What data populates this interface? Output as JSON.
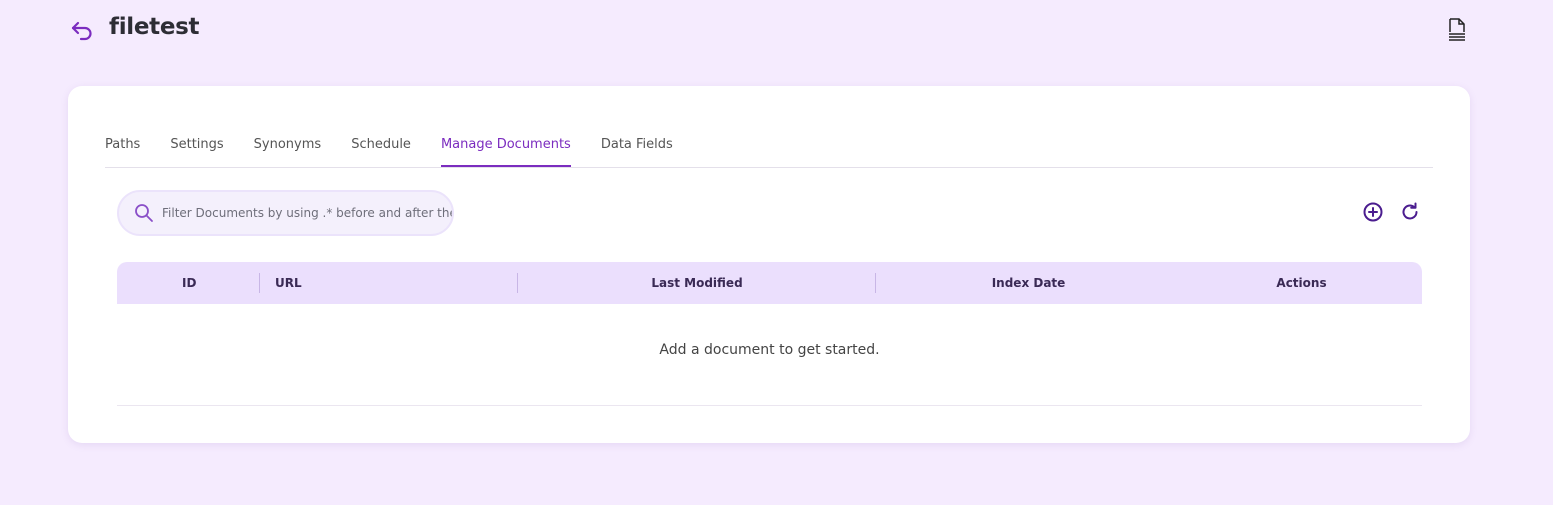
{
  "header": {
    "title": "filetest",
    "back_icon": "undo-arrow-icon",
    "doc_icon": "document-lines-icon"
  },
  "tabs": [
    {
      "label": "Paths",
      "active": false
    },
    {
      "label": "Settings",
      "active": false
    },
    {
      "label": "Synonyms",
      "active": false
    },
    {
      "label": "Schedule",
      "active": false
    },
    {
      "label": "Manage Documents",
      "active": true
    },
    {
      "label": "Data Fields",
      "active": false
    }
  ],
  "search": {
    "placeholder": "Filter Documents by using .* before and after the",
    "value": ""
  },
  "toolbar": {
    "add_icon": "plus-circle-icon",
    "refresh_icon": "refresh-icon"
  },
  "table": {
    "columns": [
      "ID",
      "URL",
      "Last Modified",
      "Index Date",
      "Actions"
    ],
    "rows": [],
    "empty_message": "Add a document to get started."
  },
  "colors": {
    "background": "#f5ebfe",
    "accent": "#7b2cbf",
    "header_row": "#ebdffd",
    "icon_dark": "#4b1d8f"
  }
}
